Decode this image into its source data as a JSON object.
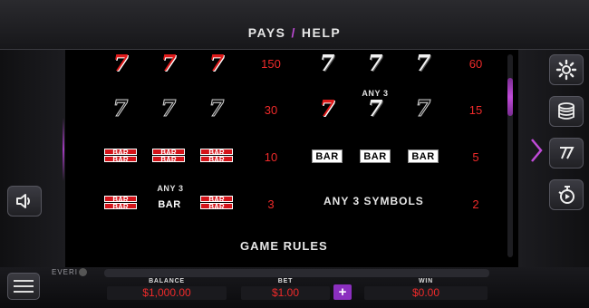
{
  "header": {
    "title_left": "PAYS",
    "separator": "/",
    "title_right": "HELP"
  },
  "paytable": {
    "row1_left_pay": "150",
    "row1_right_pay": "60",
    "row2_any3_label": "ANY 3",
    "row2_left_pay": "30",
    "row2_right_pay": "15",
    "row3_left_pay": "10",
    "row3_right_pay": "5",
    "row4_any3_label": "ANY 3",
    "row4_left_pay": "3",
    "row4_any_symbols": "ANY 3 SYMBOLS",
    "row4_right_pay": "2",
    "seven_glyph": "7",
    "bar_label": "BAR"
  },
  "section": {
    "game_rules": "GAME RULES"
  },
  "brand": {
    "name": "EVERI"
  },
  "footer": {
    "balance_label": "BALANCE",
    "balance_value": "$1,000.00",
    "bet_label": "BET",
    "bet_value": "$1.00",
    "win_label": "WIN",
    "win_value": "$0.00",
    "plus_label": "+"
  },
  "icons": {
    "settings": "gear-icon",
    "coins": "coins-icon",
    "paytable": "sevens-icon",
    "autoplay": "autoplay-icon",
    "sound": "speaker-icon",
    "menu": "menu-icon"
  },
  "colors": {
    "accent": "#c04bd8",
    "pay_red": "#ef2a2a"
  }
}
